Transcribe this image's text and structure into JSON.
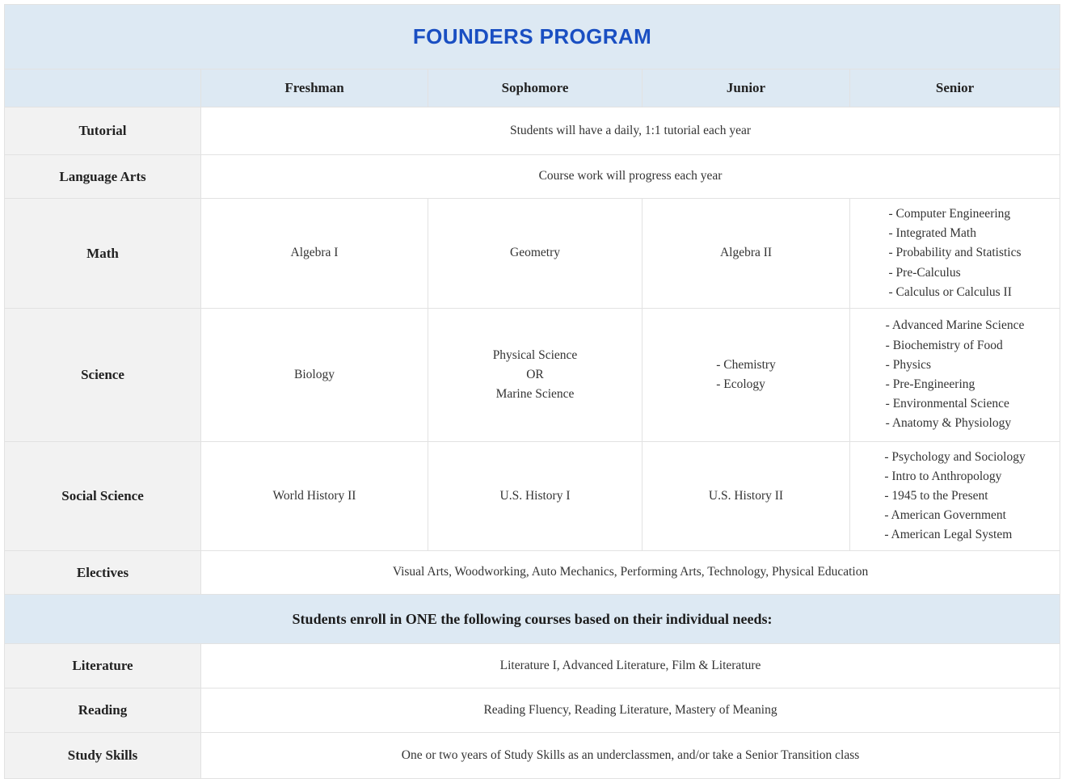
{
  "header": {
    "title": "FOUNDERS PROGRAM",
    "title_color": "#1a4fc2",
    "header_bg": "#dde9f3",
    "label_bg": "#f2f2f2",
    "columns": [
      "Freshman",
      "Sophomore",
      "Junior",
      "Senior"
    ]
  },
  "rows": {
    "tutorial": {
      "label": "Tutorial",
      "merged_text": "Students will have a daily, 1:1 tutorial each year"
    },
    "language_arts": {
      "label": "Language Arts",
      "merged_text": "Course work will progress each year"
    },
    "math": {
      "label": "Math",
      "freshman": "Algebra I",
      "sophomore": "Geometry",
      "junior": "Algebra II",
      "senior": [
        "- Computer Engineering",
        "- Integrated Math",
        "- Probability and Statistics",
        "- Pre-Calculus",
        "- Calculus or Calculus II"
      ]
    },
    "science": {
      "label": "Science",
      "freshman": "Biology",
      "sophomore": [
        "Physical Science",
        "OR",
        "Marine Science"
      ],
      "junior": [
        "- Chemistry",
        "- Ecology"
      ],
      "senior": [
        "- Advanced Marine Science",
        "- Biochemistry of Food",
        "- Physics",
        "- Pre-Engineering",
        "- Environmental Science",
        "- Anatomy & Physiology"
      ]
    },
    "social_science": {
      "label": "Social Science",
      "freshman": "World History II",
      "sophomore": "U.S. History I",
      "junior": "U.S. History II",
      "senior": [
        "- Psychology and Sociology",
        "- Intro to Anthropology",
        "- 1945 to the Present",
        "- American Government",
        "- American Legal System"
      ]
    },
    "electives": {
      "label": "Electives",
      "merged_text": "Visual Arts, Woodworking, Auto Mechanics, Performing Arts, Technology, Physical Education"
    },
    "banner": {
      "text": "Students enroll in ONE the following courses based on their individual needs:"
    },
    "literature": {
      "label": "Literature",
      "merged_text": "Literature I, Advanced Literature, Film & Literature"
    },
    "reading": {
      "label": "Reading",
      "merged_text": "Reading Fluency, Reading Literature, Mastery of Meaning"
    },
    "study_skills": {
      "label": "Study Skills",
      "merged_text": "One or two years of Study Skills as an underclassmen, and/or take a Senior Transition class"
    }
  }
}
